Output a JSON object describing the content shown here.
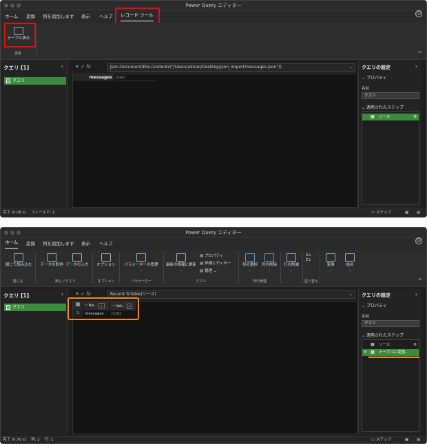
{
  "window_title": "Power Query エディター",
  "w1": {
    "menu": [
      "ホーム",
      "変換",
      "列を追加します",
      "表示",
      "ヘルプ",
      "レコード ツール"
    ],
    "ribbon_button": "テーブル表示",
    "ribbon_group": "変換",
    "left_title": "クエリ [1]",
    "query_item": "クエリ",
    "formula": "Json.Document(File.Contents(\"/Users/akirao/Desktop/json_import/messages.json\"))",
    "grid_field": "messages",
    "grid_value": "[List]",
    "settings_title": "クエリの設定",
    "properties_label": "プロパティ",
    "name_label": "名前",
    "name_value": "クエリ",
    "applied_steps_label": "適用されたステップ",
    "steps": [
      "ソース"
    ],
    "status_left": "完了 (0.08 s)　 フィールド: 1",
    "status_step": "ステップ"
  },
  "w2": {
    "menu": [
      "ホーム",
      "変換",
      "列を追加します",
      "表示",
      "ヘルプ"
    ],
    "ribbon": {
      "close_load": "閉じて読み込む",
      "get_data": "データを取得",
      "enter_data": "データの入力",
      "options": "オプション",
      "manage_params": "パラメーターの管理",
      "refresh": "最新の情報に更新",
      "properties": "プロパティ",
      "advanced_editor": "詳細エディター",
      "manage": "管理",
      "choose_columns": "列の選択",
      "remove_columns": "列の削除",
      "reduce_rows": "行の削減",
      "transform": "変換",
      "combine": "結合",
      "groups": [
        "閉じる",
        "新しいクエリ",
        "オプション",
        "パラメーター",
        "クエリ",
        "列の管理",
        "並べ替え"
      ]
    },
    "left_title": "クエリ [1]",
    "query_item": "クエリ",
    "formula": "Record.ToTable(ソース)",
    "col1_header": "Na...",
    "col1_type": "A⁠B",
    "col2_header": "Val...",
    "col2_type": "ABC\n123",
    "row_num": "1",
    "cell_name": "messages",
    "cell_value": "[List]",
    "settings_title": "クエリの設定",
    "properties_label": "プロパティ",
    "name_label": "名前",
    "name_value": "クエリ",
    "applied_steps_label": "適用されたステップ",
    "steps": [
      "ソース",
      "テーブルに変換..."
    ],
    "status_left": "完了 (0.70 s)　 列: 2　 行: 1",
    "status_step": "ステップ"
  },
  "colors": {
    "highlight_red": "#e01010",
    "highlight_orange": "#f08a1a",
    "step_green": "#3c8a3c"
  }
}
